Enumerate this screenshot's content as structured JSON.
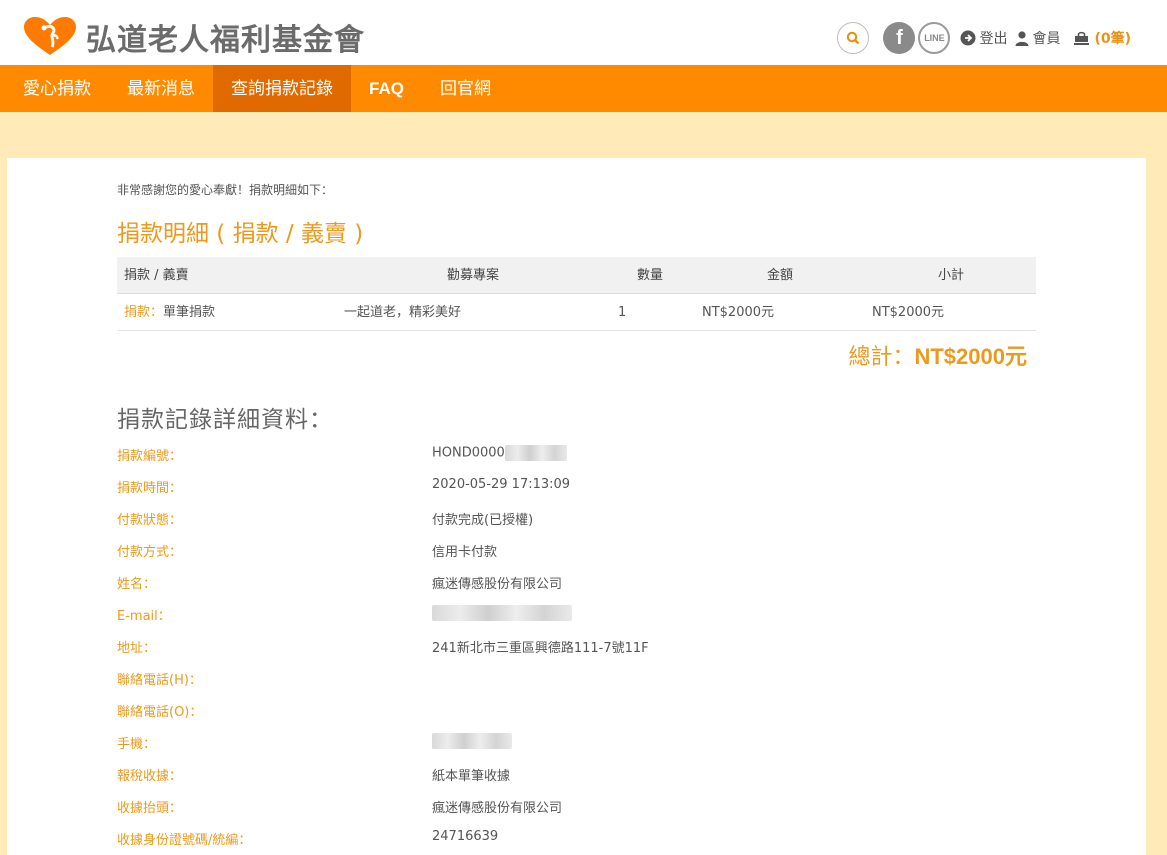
{
  "header": {
    "logo_text": "弘道老人福利基金會",
    "line_label": "LINE",
    "logout_label": "登出",
    "member_label": "會員",
    "cart_label": "(0筆)"
  },
  "colors": {
    "accent": "#ff8a00",
    "accent_dark": "#e06a00",
    "label": "#ed9a1c",
    "cream": "#ffeab8"
  },
  "nav": {
    "items": [
      {
        "label": "愛心捐款"
      },
      {
        "label": "最新消息"
      },
      {
        "label": "查詢捐款記錄",
        "active": true
      },
      {
        "label": "FAQ"
      },
      {
        "label": "回官網"
      }
    ]
  },
  "main": {
    "intro": "非常感謝您的愛心奉獻！捐款明細如下：",
    "section_title": "捐款明細 ( 捐款 / 義賣 )",
    "table": {
      "headers": [
        "捐款 / 義賣",
        "勸募專案",
        "數量",
        "金額",
        "小計"
      ],
      "rows": [
        {
          "type": "捐款：",
          "type_detail": "單筆捐款",
          "project": "一起道老，精彩美好",
          "qty": "1",
          "amount": "NT$2000元",
          "subtotal": "NT$2000元"
        }
      ]
    },
    "total_label": "總計：",
    "total_value": "NT$2000元",
    "detail_title": "捐款記錄詳細資料：",
    "fields": [
      {
        "label": "捐款編號：",
        "value": "HOND0000"
      },
      {
        "label": "捐款時間：",
        "value": "2020-05-29 17:13:09"
      },
      {
        "label": "付款狀態：",
        "value": "付款完成(已授權)"
      },
      {
        "label": "付款方式：",
        "value": "信用卡付款"
      },
      {
        "label": "姓名：",
        "value": "瘋迷傳感股份有限公司"
      },
      {
        "label": "E-mail：",
        "value": ""
      },
      {
        "label": "地址：",
        "value": "241新北市三重區興德路111-7號11F"
      },
      {
        "label": "聯絡電話(H)：",
        "value": ""
      },
      {
        "label": "聯絡電話(O)：",
        "value": ""
      },
      {
        "label": "手機：",
        "value": ""
      },
      {
        "label": "報稅收據：",
        "value": "紙本單筆收據"
      },
      {
        "label": "收據抬頭：",
        "value": "瘋迷傳感股份有限公司"
      },
      {
        "label": "收據身份證號碼/統編：",
        "value": "24716639"
      }
    ]
  }
}
